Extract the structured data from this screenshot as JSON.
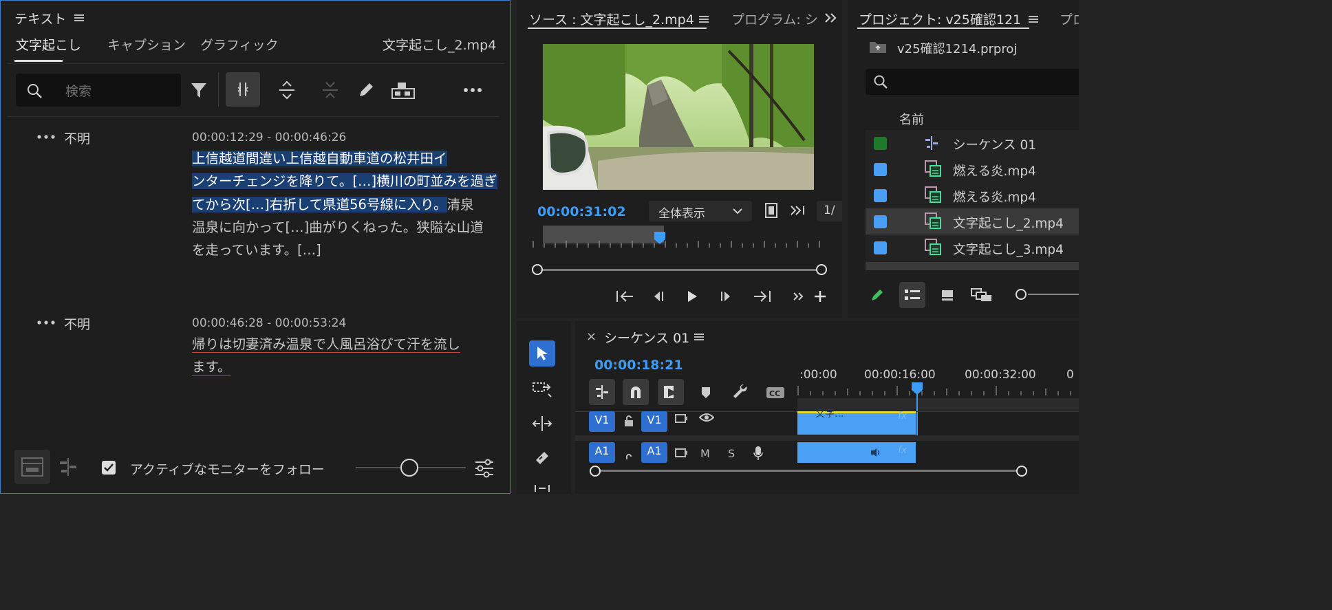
{
  "text_panel": {
    "title": "テキスト",
    "tabs": [
      "文字起こし",
      "キャプション",
      "グラフィック"
    ],
    "file_name": "文字起こし_2.mp4",
    "search_placeholder": "検索",
    "segments": [
      {
        "speaker": "不明",
        "timecode": "00:00:12:29 - 00:00:46:26",
        "lines": [
          {
            "sel": "上信越道間違い上信越自動車道の松井田イ",
            "rest": ""
          },
          {
            "sel": "ンターチェンジを降りて。[…]横川の町並みを過ぎ",
            "rest": ""
          },
          {
            "sel": "てから次[…]右折して県道56号線に入り。",
            "rest": "清泉"
          },
          {
            "sel": "",
            "rest": "温泉に向かって[…]曲がりくねった。狭隘な山道"
          },
          {
            "sel": "",
            "rest": "を走っています。[…]"
          }
        ]
      },
      {
        "speaker": "不明",
        "timecode": "00:00:46:28 - 00:00:53:24",
        "lines": [
          {
            "sel": "",
            "rest": "帰りは切妻済み温泉で人風呂浴びて汗を流し"
          },
          {
            "sel": "",
            "rest": "ます。"
          }
        ]
      }
    ],
    "follow_label": "アクティブなモニターをフォロー",
    "follow_checked": "true"
  },
  "source_panel": {
    "tab_source": "ソース : 文字起こし_2.mp4",
    "tab_program": "プログラム: シ",
    "timecode": "00:00:31:02",
    "zoom_select": "全体表示",
    "resolution": "1/"
  },
  "project_panel": {
    "tab_project": "プロジェクト: v25確認121",
    "tab_other": "プロ",
    "file_name": "v25確認1214.prproj",
    "column_name": "名前",
    "items": [
      {
        "name": "シーケンス 01",
        "color": "#1f7a2e",
        "kind": "sequence"
      },
      {
        "name": "燃える炎.mp4",
        "color": "#4a9ff5",
        "kind": "clip"
      },
      {
        "name": "燃える炎.mp4",
        "color": "#4a9ff5",
        "kind": "clip"
      },
      {
        "name": "文字起こし_2.mp4",
        "color": "#4a9ff5",
        "kind": "clip"
      },
      {
        "name": "文字起こし_3.mp4",
        "color": "#4a9ff5",
        "kind": "clip"
      }
    ]
  },
  "timeline_panel": {
    "close": "×",
    "sequence_name": "シーケンス 01",
    "timecode": "00:00:18:21",
    "ruler": [
      ":00:00",
      "00:00:16:00",
      "00:00:32:00",
      "0"
    ],
    "tracks": {
      "v1_left": "V1",
      "v1_right": "V1",
      "a1_left": "A1",
      "a1_right": "A1",
      "mute": "M",
      "solo": "S",
      "clip_label": "文字..."
    }
  },
  "icons": [
    "hamburger-icon",
    "search-icon",
    "filter-icon",
    "split-icon",
    "expand-icon",
    "collapse-icon",
    "pencil-icon",
    "speaker-icon",
    "more-icon",
    "play-icon",
    "selection-tool-icon",
    "razor-icon",
    "wrench-icon",
    "marker-icon",
    "magnet-icon",
    "eye-icon",
    "lock-icon",
    "mic-icon",
    "fx-icon"
  ],
  "colors": {
    "accent": "#3d9cf5",
    "selection": "#1a3f73",
    "clip": "#4a9ff5",
    "spelling": "#c0453c"
  }
}
